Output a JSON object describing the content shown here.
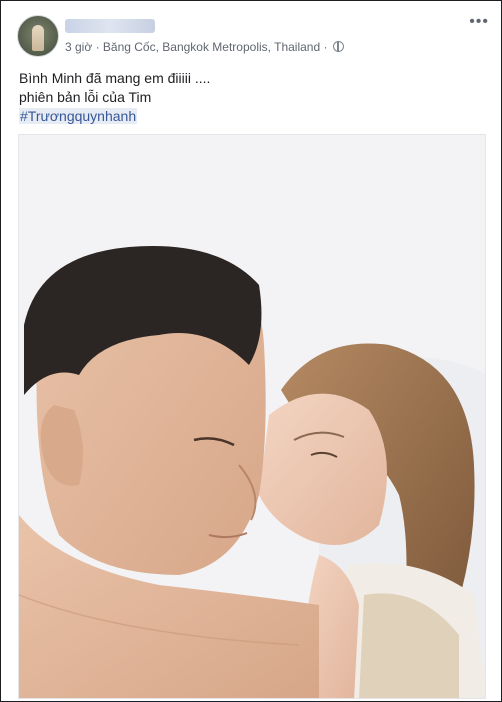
{
  "post": {
    "meta": {
      "time": "3 giờ",
      "separator": "·",
      "location": "Băng Cốc, Bangkok Metropolis, Thailand",
      "separator2": "·",
      "audience_icon": "globe-icon"
    },
    "menu_icon": "more-options-icon",
    "menu_glyph": "•••",
    "text_lines": [
      "Bình Minh đã mang em điiiii ....",
      "phiên bản lỗi của Tim"
    ],
    "hashtag": "#Trươngquynhanh"
  }
}
